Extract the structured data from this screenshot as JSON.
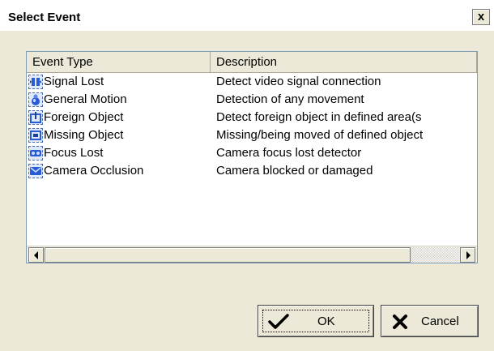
{
  "window": {
    "title": "Select Event",
    "close_label": "x"
  },
  "list": {
    "columns": [
      "Event Type",
      "Description"
    ],
    "rows": [
      {
        "name": "Signal Lost",
        "description": "Detect video signal connection",
        "icon": "signal-lost-icon"
      },
      {
        "name": "General Motion",
        "description": "Detection of any movement",
        "icon": "general-motion-icon"
      },
      {
        "name": "Foreign Object",
        "description": "Detect foreign object in defined area(s",
        "icon": "foreign-object-icon"
      },
      {
        "name": "Missing Object",
        "description": "Missing/being moved of defined object",
        "icon": "missing-object-icon"
      },
      {
        "name": "Focus Lost",
        "description": "Camera focus lost detector",
        "icon": "focus-lost-icon"
      },
      {
        "name": "Camera Occlusion",
        "description": "Camera blocked or damaged",
        "icon": "camera-occlusion-icon"
      }
    ]
  },
  "buttons": {
    "ok_label": "OK",
    "cancel_label": "Cancel"
  }
}
